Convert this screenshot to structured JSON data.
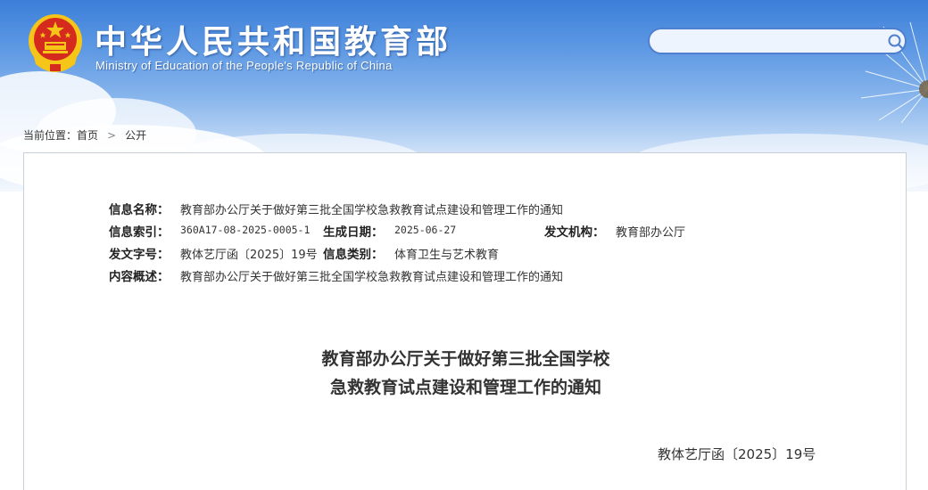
{
  "header": {
    "title": "中华人民共和国教育部",
    "subtitle": "Ministry of Education of the People's Republic of China",
    "emblem": "national-emblem",
    "search": {
      "value": "",
      "placeholder": "",
      "icon": "search-icon"
    }
  },
  "breadcrumb": {
    "prefix": "当前位置：",
    "items": [
      "首页",
      "公开"
    ],
    "separator": ">"
  },
  "meta": {
    "name_label": "信息名称：",
    "name_value": "教育部办公厅关于做好第三批全国学校急救教育试点建设和管理工作的通知",
    "index_label": "信息索引：",
    "index_value": "360A17-08-2025-0005-1",
    "date_label": "生成日期：",
    "date_value": "2025-06-27",
    "issuer_label": "发文机构：",
    "issuer_value": "教育部办公厅",
    "docno_label": "发文字号：",
    "docno_value": "教体艺厅函〔2025〕19号",
    "category_label": "信息类别：",
    "category_value": "体育卫生与艺术教育",
    "summary_label": "内容概述：",
    "summary_value": "教育部办公厅关于做好第三批全国学校急救教育试点建设和管理工作的通知"
  },
  "document": {
    "title_line1": "教育部办公厅关于做好第三批全国学校",
    "title_line2": "急救教育试点建设和管理工作的通知",
    "number": "教体艺厅函〔2025〕19号"
  },
  "colors": {
    "banner_top": "#3c7fd9",
    "banner_bottom": "#f4f8fe",
    "search_border": "#4f7fcf",
    "emblem_red": "#d52b1e",
    "emblem_gold": "#f5c518",
    "panel_border": "#c9cfd8",
    "text": "#333333"
  }
}
